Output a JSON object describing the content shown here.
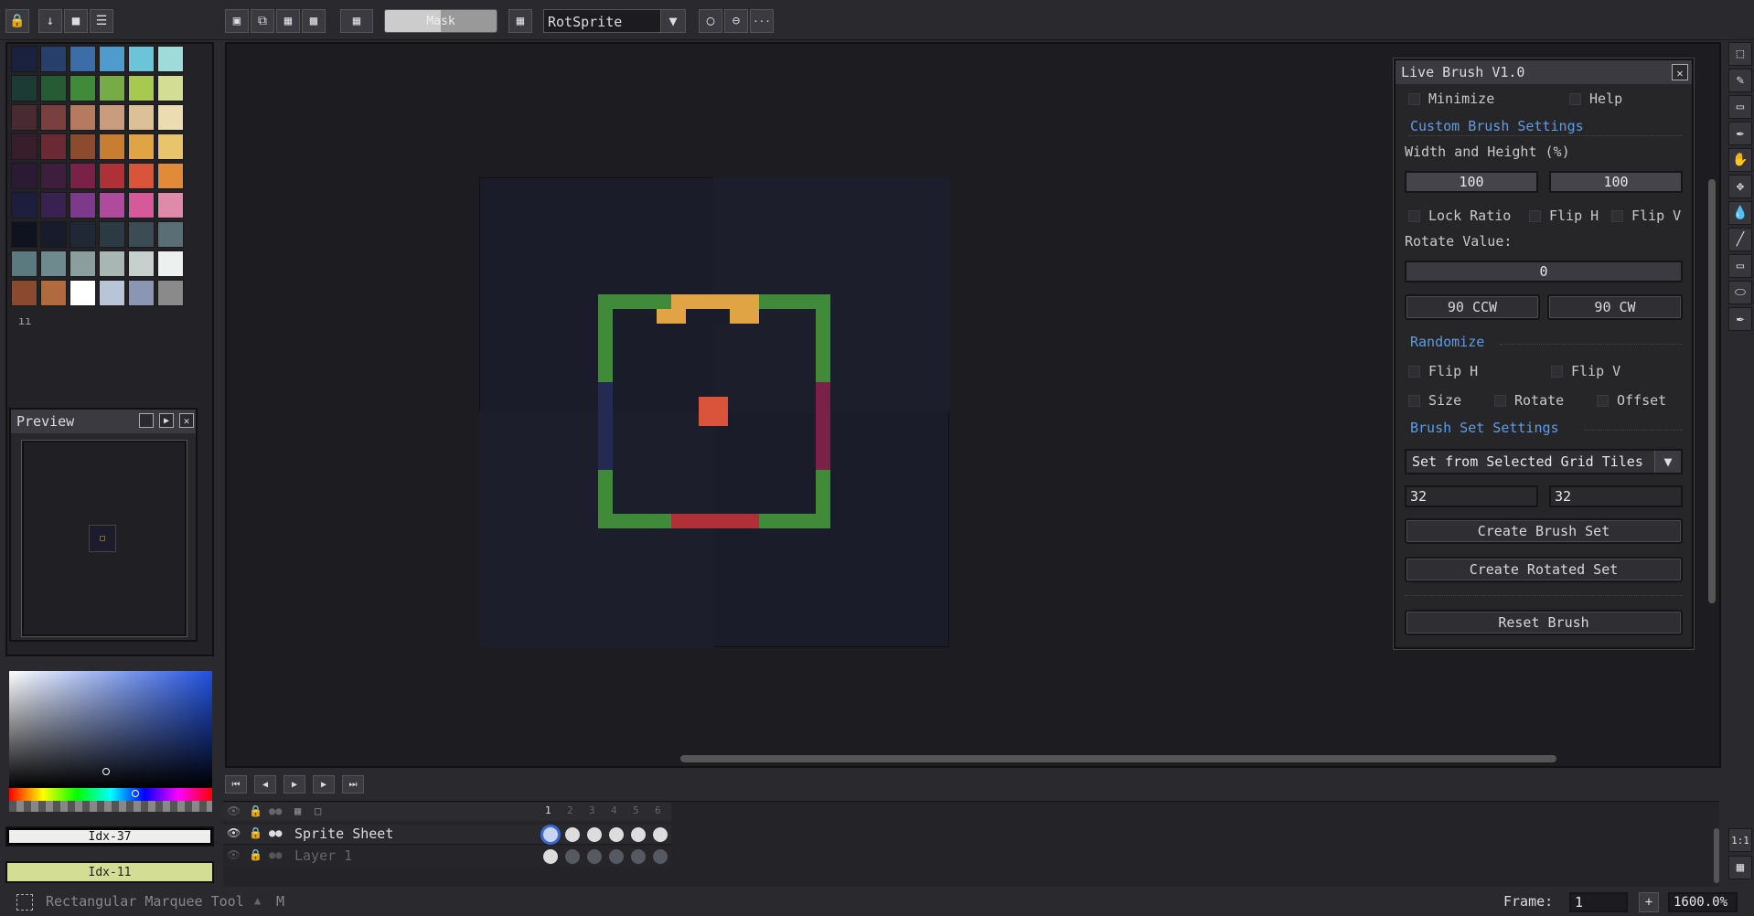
{
  "toolbar": {
    "mask_label": "Mask",
    "rotation_algorithm": "RotSprite",
    "more_label": "···"
  },
  "preview": {
    "title": "Preview"
  },
  "palette": {
    "colors": [
      [
        "#1b2240",
        "#27406b",
        "#3c6da8",
        "#4f9bce",
        "#6cc4d8",
        "#9fdbd8"
      ],
      [
        "#1d3b35",
        "#255c34",
        "#3f8b3a",
        "#76ab46",
        "#a7c94f",
        "#d4dd94"
      ],
      [
        "#4a2a31",
        "#7a4040",
        "#b57a5f",
        "#c99c7e",
        "#dcc098",
        "#ebdcb2"
      ],
      [
        "#3a1d2a",
        "#6b2a33",
        "#8c4a2e",
        "#c97d30",
        "#e0a444",
        "#e8c46a"
      ],
      [
        "#2a1a33",
        "#3d1f3d",
        "#7a2148",
        "#b03038",
        "#d9543a",
        "#e08a3a"
      ],
      [
        "#1d1d3d",
        "#3a2250",
        "#7d3a8a",
        "#b04a9a",
        "#d65a9a",
        "#e08aaa"
      ],
      [
        "#0f1320",
        "#181c2a",
        "#202836",
        "#2c3a44",
        "#3c4c55",
        "#5a6e75"
      ],
      [
        "#5a7a80",
        "#6e8a8e",
        "#8a9e9e",
        "#a8b6b4",
        "#c8d0ce",
        "#ecf0ee"
      ],
      [
        "#8a4a30",
        "#b06a3e",
        "#ffffff",
        "#b8c4d8",
        "#8a96b4",
        "#8a8a8a"
      ]
    ],
    "page_indicator": "ıı"
  },
  "color_picker": {
    "primary_label": "Idx-37",
    "secondary_label": "Idx-11",
    "primary_color": "#eeeeee",
    "secondary_color": "#d4dd94"
  },
  "live_brush": {
    "title": "Live Brush V1.0",
    "minimize_label": "Minimize",
    "help_label": "Help",
    "custom_brush_header": "Custom Brush Settings",
    "width_height_label": "Width and Height (%)",
    "width_value": "100",
    "height_value": "100",
    "lock_ratio_label": "Lock Ratio",
    "flip_h_label": "Flip H",
    "flip_v_label": "Flip V",
    "rotate_value_label": "Rotate Value:",
    "rotate_value": "0",
    "ccw_label": "90 CCW",
    "cw_label": "90 CW",
    "randomize_header": "Randomize",
    "rand_flip_h_label": "Flip H",
    "rand_flip_v_label": "Flip V",
    "size_label": "Size",
    "rotate_label": "Rotate",
    "offset_label": "Offset",
    "brush_set_header": "Brush Set Settings",
    "brush_set_mode": "Set from Selected Grid Tiles",
    "grid_w": "32",
    "grid_h": "32",
    "create_brush_set_label": "Create Brush Set",
    "create_rotated_set_label": "Create Rotated Set",
    "reset_brush_label": "Reset Brush"
  },
  "timeline": {
    "frame_numbers": [
      "1",
      "2",
      "3",
      "4",
      "5",
      "6"
    ],
    "layers": [
      {
        "name": "Sprite Sheet"
      },
      {
        "name": "Layer 1"
      }
    ]
  },
  "status": {
    "tool_name": "Rectangular Marquee Tool",
    "tool_shortcut": "M",
    "frame_label": "Frame:",
    "frame_value": "1",
    "zoom_value": "1600.0%",
    "zoom_add": "+"
  },
  "right_tools": {
    "fit_label": "1:1"
  },
  "colors": {
    "accent_blue": "#5c9de6",
    "sprite_green": "#3f8b3a",
    "sprite_orange": "#e0a444",
    "sprite_red": "#b03038",
    "sprite_center": "#d9543a"
  }
}
